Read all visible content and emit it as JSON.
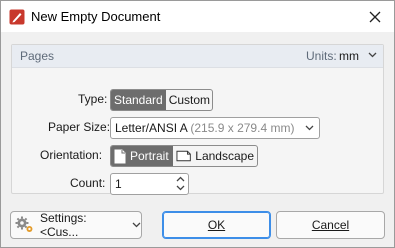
{
  "window": {
    "title": "New Empty Document"
  },
  "group": {
    "title": "Pages",
    "units_label": "Units:",
    "units_value": "mm"
  },
  "type": {
    "label": "Type:",
    "options": [
      "Standard",
      "Custom"
    ],
    "selected": "Standard"
  },
  "paper_size": {
    "label": "Paper Size:",
    "value": "Letter/ANSI A",
    "dimensions": "(215.9 x 279.4 mm)"
  },
  "orientation": {
    "label": "Orientation:",
    "options": [
      "Portrait",
      "Landscape"
    ],
    "selected": "Portrait"
  },
  "count": {
    "label": "Count:",
    "value": "1"
  },
  "buttons": {
    "settings": "Settings: <Cus...",
    "ok": "OK",
    "cancel": "Cancel"
  },
  "colors": {
    "accent": "#3d8ee8",
    "segment_active": "#6d6d6d",
    "app_icon": "#c8382c"
  }
}
